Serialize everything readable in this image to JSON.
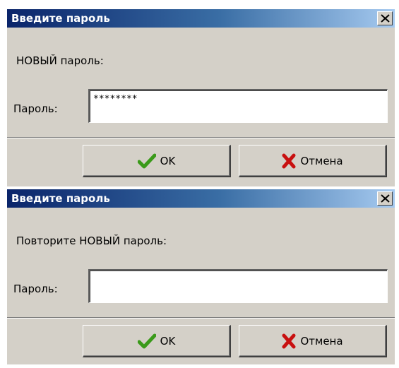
{
  "dialogs": [
    {
      "title": "Введите пароль",
      "prompt": "НОВЫЙ пароль:",
      "field_label": "Пароль:",
      "password_value": "********",
      "ok_label": "OK",
      "cancel_label": "Отмена"
    },
    {
      "title": "Введите пароль",
      "prompt": "Повторите НОВЫЙ пароль:",
      "field_label": "Пароль:",
      "password_value": "",
      "ok_label": "OK",
      "cancel_label": "Отмена"
    }
  ],
  "icons": {
    "close": "close-icon",
    "ok": "green-checkmark-icon",
    "cancel": "red-x-icon"
  },
  "colors": {
    "dialog_bg": "#d4d0c8",
    "titlebar_start": "#0a246a",
    "titlebar_end": "#a6caf0",
    "ok_icon": "#3a9a1a",
    "cancel_icon": "#c81010"
  }
}
